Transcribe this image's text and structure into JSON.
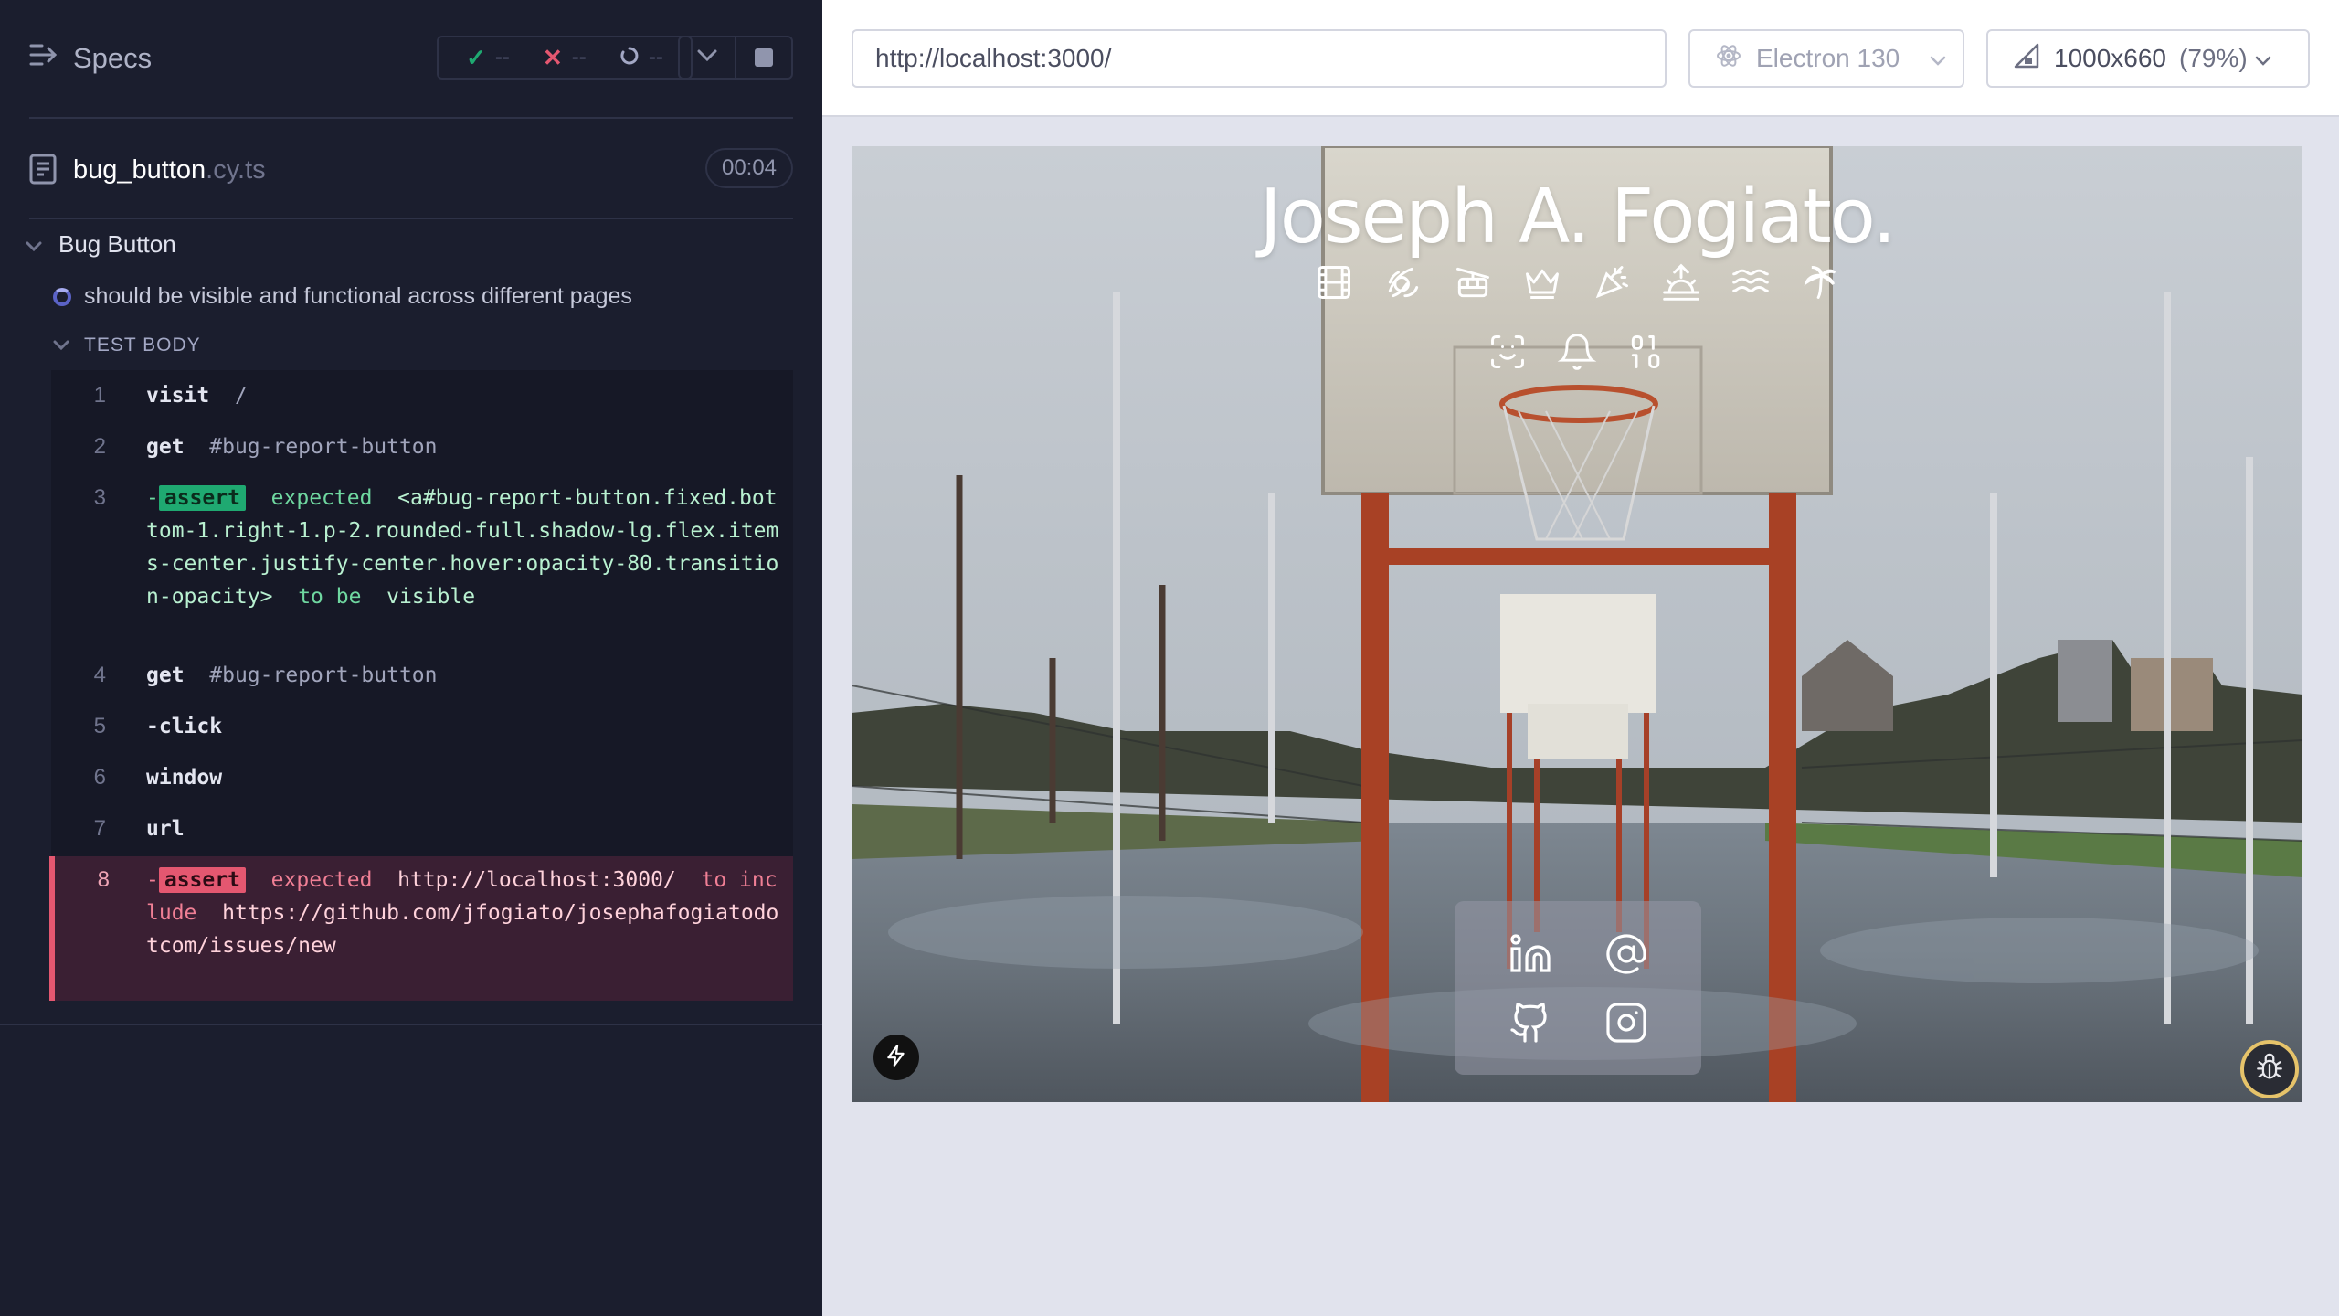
{
  "reporter": {
    "specs_label": "Specs",
    "stats": {
      "passed": "--",
      "failed": "--",
      "pending": "--"
    },
    "file": {
      "name": "bug_button",
      "ext": ".cy.ts",
      "duration": "00:04"
    },
    "suite_title": "Bug Button",
    "test_title": "should be visible and functional across different pages",
    "body_label": "TEST BODY",
    "commands": [
      {
        "num": "1",
        "name": "visit",
        "arg": "/"
      },
      {
        "num": "2",
        "name": "get",
        "arg": "#bug-report-button"
      },
      {
        "num": "3",
        "prefix": "-",
        "name": "assert",
        "expected": "expected",
        "subject": "<a#bug-report-button.fixed.bottom-1.right-1.p-2.rounded-full.shadow-lg.flex.items-center.justify-center.hover:opacity-80.transition-opacity>",
        "to": "to be",
        "value": "visible"
      },
      {
        "num": "4",
        "name": "get",
        "arg": "#bug-report-button"
      },
      {
        "num": "5",
        "name": "-click",
        "arg": ""
      },
      {
        "num": "6",
        "name": "window",
        "arg": ""
      },
      {
        "num": "7",
        "name": "url",
        "arg": ""
      },
      {
        "num": "8",
        "prefix": "-",
        "name": "assert",
        "expected": "expected",
        "subject": "http://localhost:3000/",
        "to": "to include",
        "value": "https://github.com/jfogiato/josephafogiatodotcom/issues/new"
      }
    ]
  },
  "toolbar": {
    "url": "http://localhost:3000/",
    "browser": "Electron 130",
    "viewport": "1000x660",
    "zoom": "(79%)"
  },
  "aut": {
    "site_title": "Joseph A. Fogiato.",
    "icons_row1": [
      "film-icon",
      "croissant-icon",
      "cable-car-icon",
      "crown-icon",
      "party-popper-icon",
      "sunrise-icon",
      "waves-icon",
      "palm-tree-icon"
    ],
    "icons_row2": [
      "scan-face-icon",
      "bell-icon",
      "binary-icon"
    ],
    "social": [
      "linkedin-icon",
      "at-sign-icon",
      "github-icon",
      "instagram-icon"
    ]
  },
  "colors": {
    "reporter_bg": "#1b1e2e",
    "pass": "#1fa971",
    "fail": "#e45770",
    "preview_bg": "#e1e3ed"
  }
}
